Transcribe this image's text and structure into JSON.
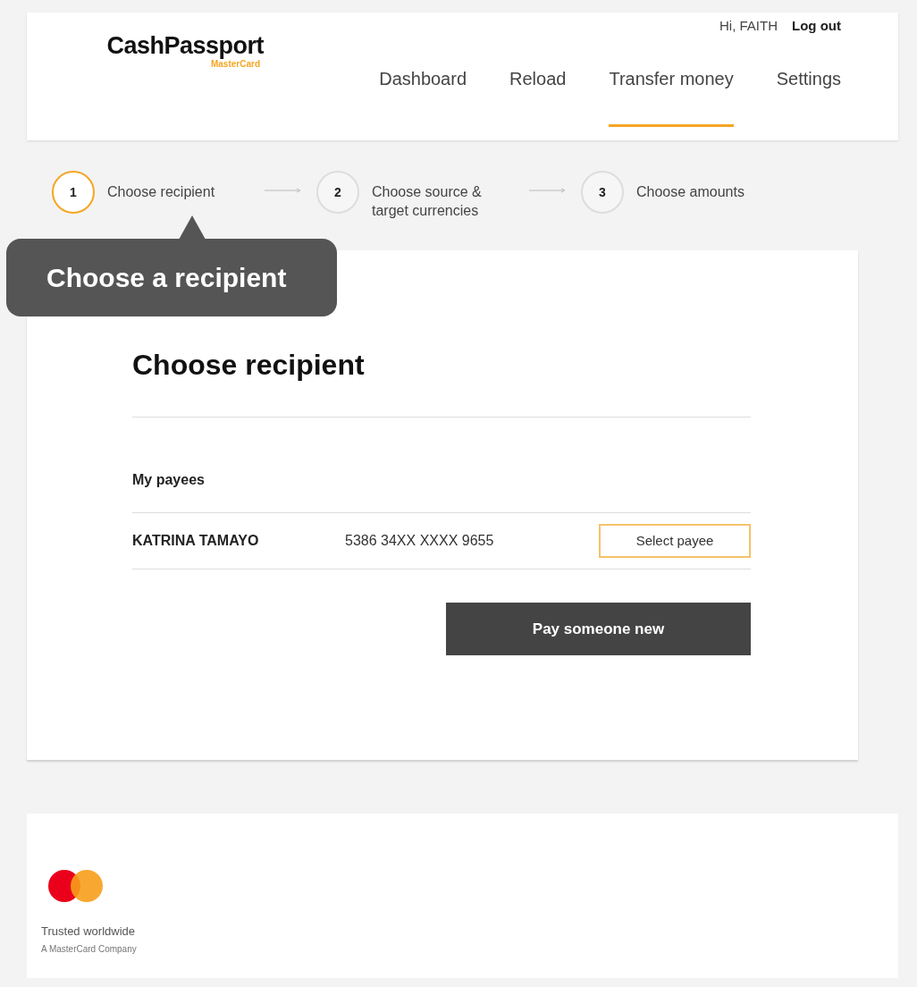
{
  "header": {
    "logo": {
      "name": "CashPassport",
      "sub": "MasterCard"
    },
    "greeting": "Hi, FAITH",
    "logout": "Log out",
    "nav": [
      {
        "label": "Dashboard",
        "selected": false
      },
      {
        "label": "Reload",
        "selected": false
      },
      {
        "label": "Transfer money",
        "selected": true
      },
      {
        "label": "Settings",
        "selected": false
      }
    ]
  },
  "steps": [
    {
      "number": "1",
      "label": "Choose recipient",
      "selected": true
    },
    {
      "number": "2",
      "label": "Choose source & target currencies",
      "selected": false
    },
    {
      "number": "3",
      "label": "Choose amounts",
      "selected": false
    }
  ],
  "callout": "Choose a recipient",
  "card": {
    "title": "Choose recipient",
    "section": "My payees",
    "payees": [
      {
        "name": "KATRINA TAMAYO",
        "card": "5386 34XX XXXX 9655",
        "action": "Select payee"
      }
    ],
    "primary_button": "Pay someone new"
  },
  "footer": {
    "tagline": "Trusted worldwide",
    "company": "A MasterCard Company"
  }
}
